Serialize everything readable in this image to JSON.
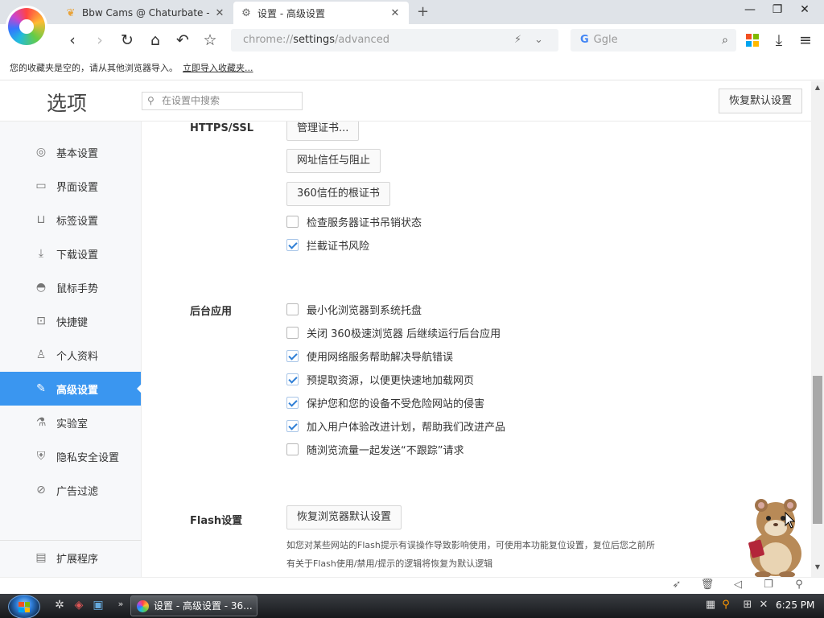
{
  "browser": {
    "tabs": [
      {
        "title": "Bbw Cams @ Chaturbate -",
        "icon": "butterfly-icon"
      },
      {
        "title": "设置 - 高级设置",
        "icon": "gear-icon",
        "active": true
      }
    ],
    "url_scheme": "chrome://",
    "url_host": "settings",
    "url_path": "/advanced",
    "search_placeholder": "Ggle",
    "search_g": "G"
  },
  "bookmarks_bar": {
    "message": "您的收藏夹是空的，请从其他浏览器导入。",
    "import_link": "立即导入收藏夹..."
  },
  "settings": {
    "title": "选项",
    "search_placeholder": "在设置中搜索",
    "reset_button": "恢复默认设置"
  },
  "sidebar": {
    "items": [
      {
        "label": "基本设置",
        "icon": "circle-settings-icon"
      },
      {
        "label": "界面设置",
        "icon": "window-icon"
      },
      {
        "label": "标签设置",
        "icon": "laptop-icon"
      },
      {
        "label": "下载设置",
        "icon": "download-icon"
      },
      {
        "label": "鼠标手势",
        "icon": "mouse-icon"
      },
      {
        "label": "快捷键",
        "icon": "shortcut-icon"
      },
      {
        "label": "个人资料",
        "icon": "person-icon"
      },
      {
        "label": "高级设置",
        "icon": "wrench-icon",
        "active": true
      },
      {
        "label": "实验室",
        "icon": "flask-icon"
      },
      {
        "label": "隐私安全设置",
        "icon": "shield-plus-icon"
      },
      {
        "label": "广告过滤",
        "icon": "block-icon"
      }
    ],
    "extensions": {
      "label": "扩展程序",
      "icon": "extension-icon"
    }
  },
  "sections": {
    "https": {
      "label": "HTTPS/SSL",
      "buttons": [
        "管理证书...",
        "网址信任与阻止",
        "360信任的根证书"
      ],
      "checkboxes": [
        {
          "label": "检查服务器证书吊销状态",
          "checked": false
        },
        {
          "label": "拦截证书风险",
          "checked": true
        }
      ]
    },
    "background": {
      "label": "后台应用",
      "checkboxes": [
        {
          "label": "最小化浏览器到系统托盘",
          "checked": false
        },
        {
          "label": "关闭 360极速浏览器 后继续运行后台应用",
          "checked": false
        },
        {
          "label": "使用网络服务帮助解决导航错误",
          "checked": true
        },
        {
          "label": "预提取资源，以便更快速地加载网页",
          "checked": true
        },
        {
          "label": "保护您和您的设备不受危险网站的侵害",
          "checked": true
        },
        {
          "label": "加入用户体验改进计划，帮助我们改进产品",
          "checked": true
        },
        {
          "label": "随浏览流量一起发送“不跟踪”请求",
          "checked": false
        }
      ]
    },
    "flash": {
      "label": "Flash设置",
      "button": "恢复浏览器默认设置",
      "desc_line1": "如您对某些网站的Flash提示有误操作导致影响使用，可使用本功能复位设置，复位后您之前所",
      "desc_line2": "有关于Flash使用/禁用/提示的逻辑将恢复为默认逻辑"
    }
  },
  "taskbar": {
    "task_label": "设置 - 高级设置 - 36...",
    "clock": "6:25 PM"
  },
  "colors": {
    "accent": "#3a96f0",
    "check": "#2f7fd6"
  }
}
